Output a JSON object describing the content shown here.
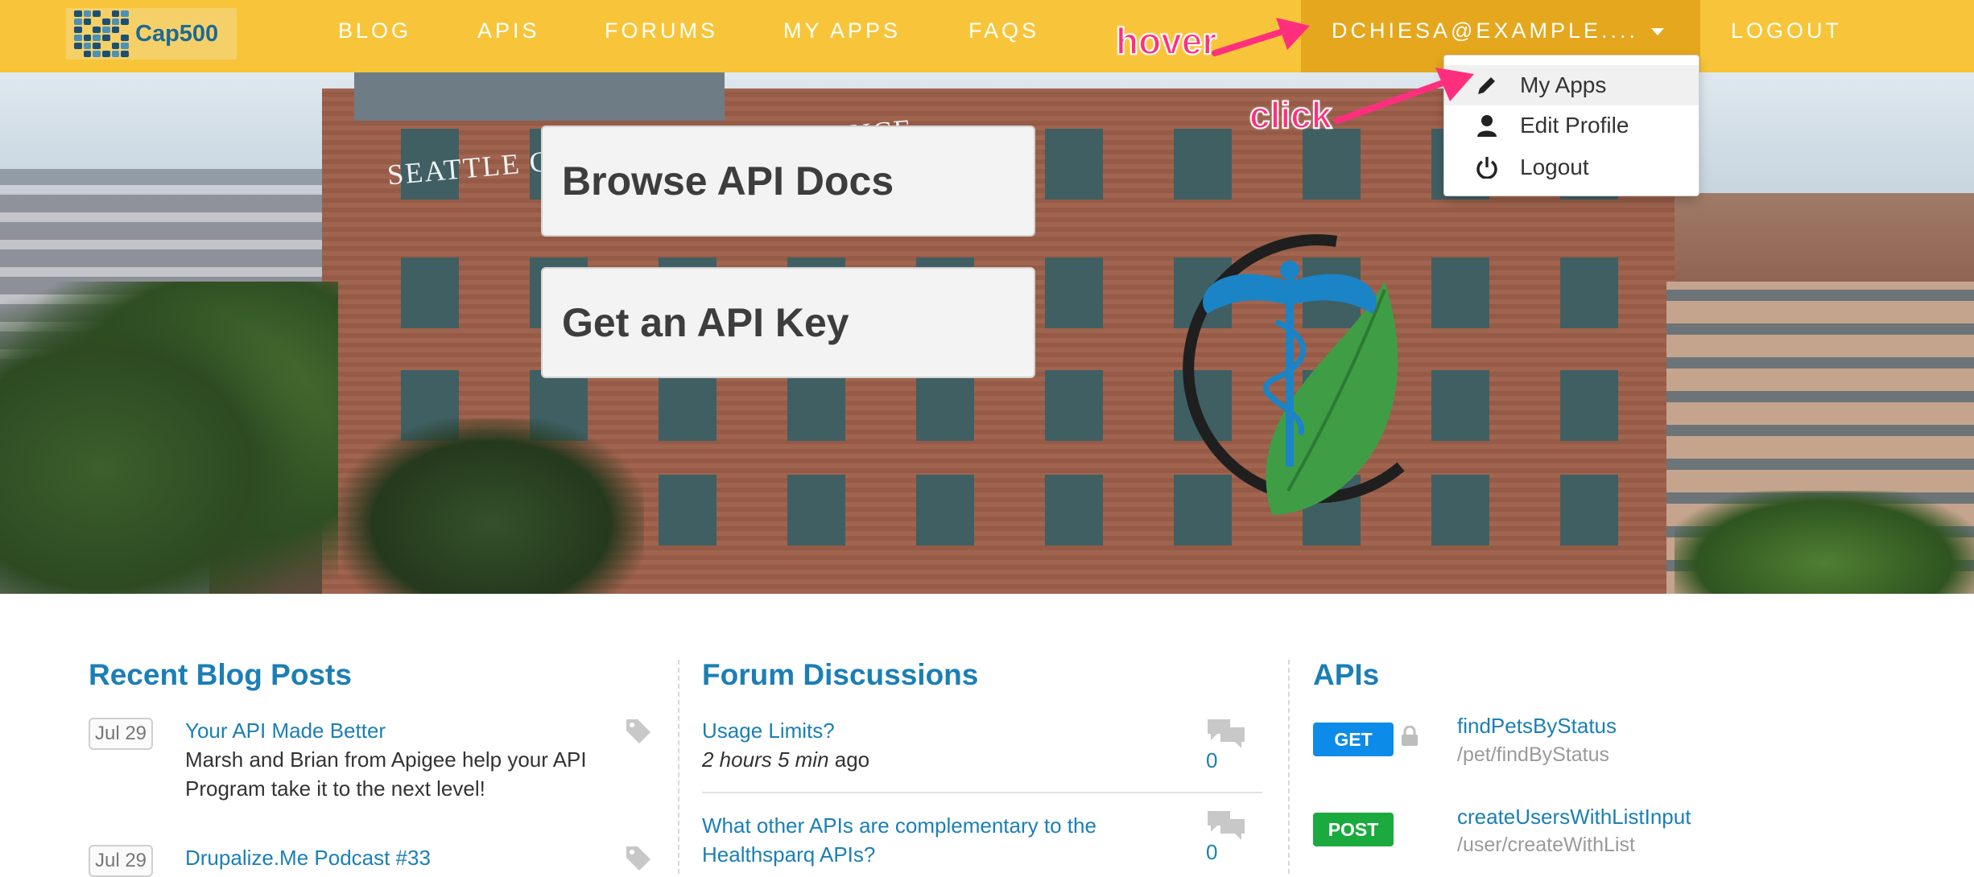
{
  "brand": {
    "logo_text": "Cap500"
  },
  "nav": {
    "items": [
      "BLOG",
      "APIS",
      "FORUMS",
      "MY APPS",
      "FAQS"
    ],
    "user_label": "DCHIESA@EXAMPLE....",
    "logout": "LOGOUT"
  },
  "dropdown": {
    "items": [
      {
        "label": "My Apps",
        "icon": "pencil-icon"
      },
      {
        "label": "Edit Profile",
        "icon": "user-icon"
      },
      {
        "label": "Logout",
        "icon": "power-icon"
      }
    ]
  },
  "annotations": {
    "hover": "hover",
    "click": "click",
    "color": "#ff2f7d"
  },
  "hero": {
    "sign_text": "SEATTLE CANCER CARE ALLIANCE",
    "buttons": [
      "Browse API Docs",
      "Get an API Key"
    ]
  },
  "blog": {
    "title": "Recent Blog Posts",
    "posts": [
      {
        "date": "Jul 29",
        "title": "Your API Made Better",
        "excerpt": "Marsh and Brian from Apigee help your API Program take it to the next level!"
      },
      {
        "date": "Jul 29",
        "title": "Drupalize.Me Podcast #33",
        "excerpt": ""
      }
    ]
  },
  "forum": {
    "title": "Forum Discussions",
    "topics": [
      {
        "title": "Usage Limits?",
        "time_em": "2 hours 5 min",
        "time_suffix": " ago",
        "count": "0"
      },
      {
        "title": "What other APIs are complementary to the Healthsparq APIs?",
        "count": "0"
      }
    ]
  },
  "apis": {
    "title": "APIs",
    "items": [
      {
        "method": "GET",
        "name": "findPetsByStatus",
        "path": "/pet/findByStatus",
        "locked": true
      },
      {
        "method": "POST",
        "name": "createUsersWithListInput",
        "path": "/user/createWithList",
        "locked": false
      }
    ]
  },
  "colors": {
    "navbar": "#f8c53a",
    "nav_active": "#e4a71e",
    "link": "#1b7fb5",
    "get": "#0d8be8",
    "post": "#1aaa3e"
  }
}
